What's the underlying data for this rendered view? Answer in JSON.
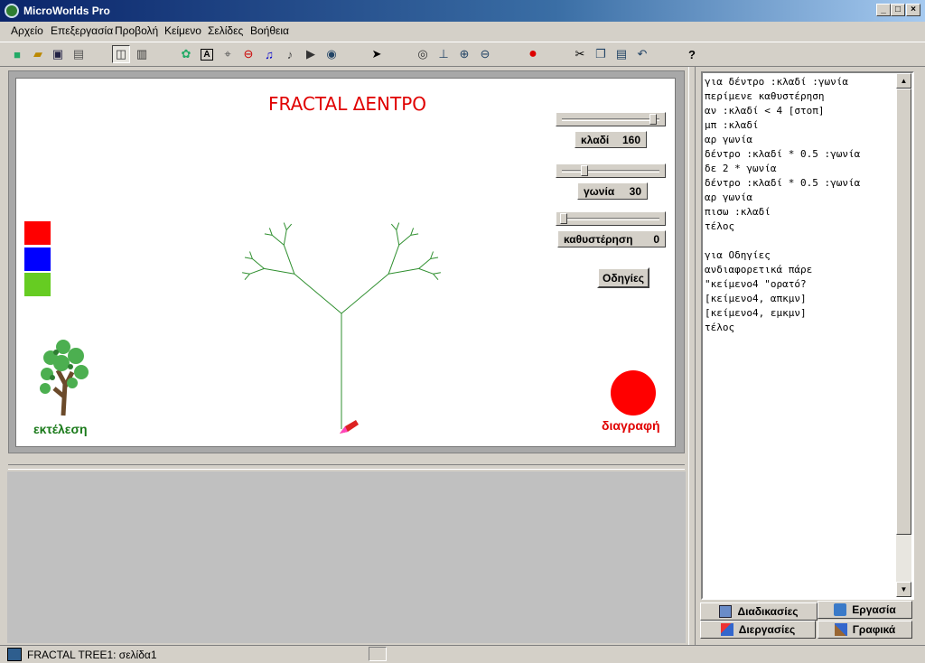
{
  "window": {
    "title": "MicroWorlds Pro"
  },
  "menu": [
    "Αρχείο",
    "Επεξεργασία",
    "Προβολή",
    "Κείμενο",
    "Σελίδες",
    "Βοήθεια"
  ],
  "stage": {
    "title": "FRACTAL ΔΕΝΤΡΟ",
    "sliders": [
      {
        "label": "κλαδί",
        "value": "160",
        "fraction": 0.95
      },
      {
        "label": "γωνία",
        "value": "30",
        "fraction": 0.22
      },
      {
        "label": "καθυστέρηση",
        "value": "0",
        "fraction": 0.0
      }
    ],
    "instructions_button": "Οδηγίες",
    "run_label": "εκτέλεση",
    "clear_label": "διαγραφή",
    "swatches": [
      "#ff0000",
      "#0000ff",
      "#66cc00"
    ]
  },
  "procedures": "για δέντρο :κλαδί :γωνία\nπερίμενε καθυστέρηση\nαν :κλαδί < 4 [στοπ]\nμπ :κλαδί\nαρ γωνία\nδέντρο :κλαδί * 0.5 :γωνία\nδε 2 * γωνία\nδέντρο :κλαδί * 0.5 :γωνία\nαρ γωνία\nπισω :κλαδί\nτέλος\n\nγια Οδηγίες\nανδιαφορετικά πάρε\n\"κείμενο4 \"ορατό?\n[κείμενο4, απκμν]\n[κείμενο4, εμκμν]\nτέλος",
  "tabs": {
    "procedures": "Διαδικασίες",
    "command": "Εργασία",
    "processes": "Διεργασίες",
    "graphics": "Γραφικά"
  },
  "status": {
    "text": "FRACTAL TREE1:  σελίδα1"
  },
  "help_button": "?"
}
